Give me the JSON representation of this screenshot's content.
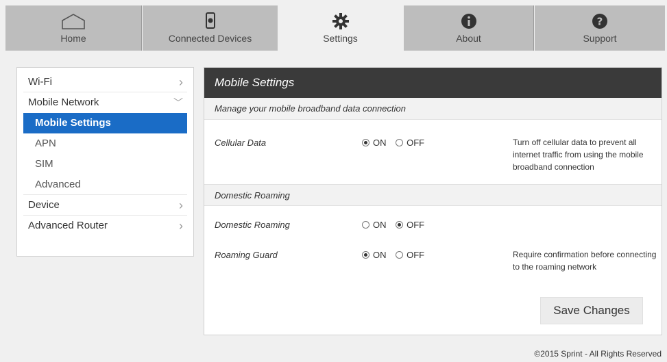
{
  "nav": {
    "tabs": [
      {
        "label": "Home",
        "icon": "home-icon"
      },
      {
        "label": "Connected Devices",
        "icon": "device-icon"
      },
      {
        "label": "Settings",
        "icon": "gear-icon"
      },
      {
        "label": "About",
        "icon": "info-icon"
      },
      {
        "label": "Support",
        "icon": "question-icon"
      }
    ],
    "active": "Settings"
  },
  "sidebar": {
    "wifi": "Wi-Fi",
    "mobile_network": "Mobile Network",
    "mobile_settings": "Mobile Settings",
    "apn": "APN",
    "sim": "SIM",
    "advanced": "Advanced",
    "device": "Device",
    "advanced_router": "Advanced Router"
  },
  "panel": {
    "title": "Mobile Settings",
    "subtitle": "Manage your mobile broadband data connection",
    "cellular_data": {
      "label": "Cellular Data",
      "on": "ON",
      "off": "OFF",
      "selected": "ON",
      "description": "Turn off cellular data to prevent all internet traffic from using the mobile broadband connection"
    },
    "roaming_section": "Domestic Roaming",
    "domestic_roaming": {
      "label": "Domestic Roaming",
      "on": "ON",
      "off": "OFF",
      "selected": "OFF"
    },
    "roaming_guard": {
      "label": "Roaming Guard",
      "on": "ON",
      "off": "OFF",
      "selected": "ON",
      "description": "Require confirmation before connecting to the roaming network"
    },
    "save_label": "Save Changes"
  },
  "footer": "©2015 Sprint - All Rights Reserved",
  "colors": {
    "accent": "#1a6cc6",
    "header": "#3a3a3a",
    "tab_bg": "#bdbdbd"
  }
}
